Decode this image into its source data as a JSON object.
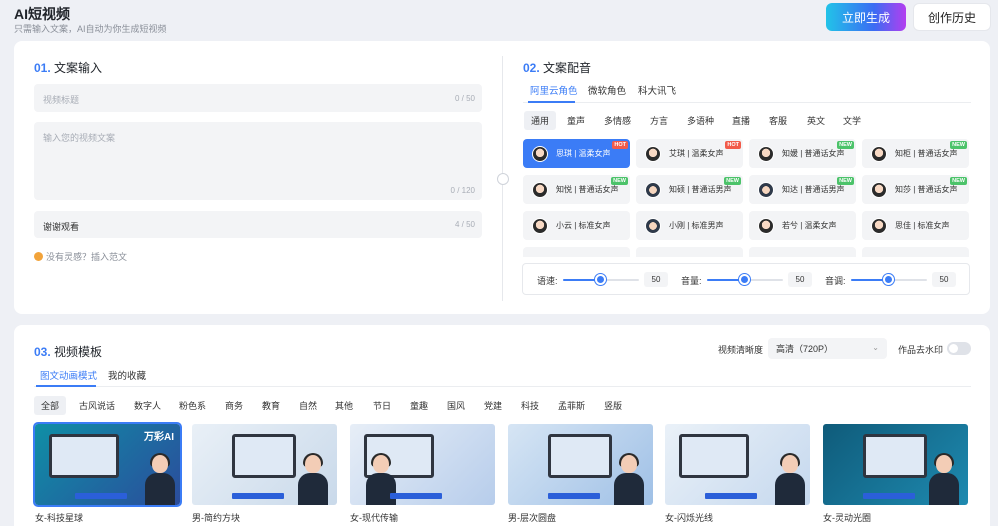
{
  "header": {
    "title": "AI短视频",
    "subtitle": "只需输入文案，AI自动为你生成短视频",
    "generate_button": "立即生成",
    "history_button": "创作历史"
  },
  "section1": {
    "num": "01.",
    "title": "文案输入",
    "title_field": {
      "placeholder": "视频标题",
      "count": "0 / 50"
    },
    "content_field": {
      "placeholder": "输入您的视频文案",
      "count": "0 / 120"
    },
    "ending_field": {
      "value": "谢谢观看",
      "count": "4 / 50"
    },
    "inspiration": "没有灵感？插入范文"
  },
  "section2": {
    "num": "02.",
    "title": "文案配音",
    "providers": [
      "阿里云角色",
      "微软角色",
      "科大讯飞"
    ],
    "categories": [
      "通用",
      "童声",
      "多情感",
      "方言",
      "多语种",
      "直播",
      "客服",
      "英文",
      "文学"
    ],
    "voices": [
      {
        "label": "思琪 | 温柔女声",
        "badge": "HOT",
        "male": false
      },
      {
        "label": "艾琪 | 温柔女声",
        "badge": "HOT",
        "male": false
      },
      {
        "label": "知媛 | 普通话女声",
        "badge": "NEW",
        "male": false
      },
      {
        "label": "知柜 | 普通话女声",
        "badge": "NEW",
        "male": false
      },
      {
        "label": "知悦 | 普通话女声",
        "badge": "NEW",
        "male": false
      },
      {
        "label": "知硕 | 普通话男声",
        "badge": "NEW",
        "male": true
      },
      {
        "label": "知达 | 普通话男声",
        "badge": "NEW",
        "male": true
      },
      {
        "label": "知莎 | 普通话女声",
        "badge": "NEW",
        "male": false
      },
      {
        "label": "小云 | 标准女声",
        "badge": "",
        "male": false
      },
      {
        "label": "小刚 | 标准男声",
        "badge": "",
        "male": true
      },
      {
        "label": "若兮 | 温柔女声",
        "badge": "",
        "male": false
      },
      {
        "label": "思佳 | 标准女声",
        "badge": "",
        "male": false
      }
    ],
    "sliders": [
      {
        "label": "语速:",
        "value": "50",
        "fraction": 0.5
      },
      {
        "label": "音量:",
        "value": "50",
        "fraction": 0.5
      },
      {
        "label": "音调:",
        "value": "50",
        "fraction": 0.5
      }
    ]
  },
  "section3": {
    "num": "03.",
    "title": "视频模板",
    "tabs": [
      "图文动画模式",
      "我的收藏"
    ],
    "quality_label": "视频清晰度",
    "quality_value": "高清（720P）",
    "watermark_label": "作品去水印",
    "filters": [
      "全部",
      "古风说话",
      "数字人",
      "粉色系",
      "商务",
      "教育",
      "自然",
      "其他",
      "节日",
      "童趣",
      "国风",
      "党建",
      "科技",
      "孟菲斯",
      "竖版"
    ],
    "templates": [
      {
        "name": "女-科技星球",
        "brand": "万彩AI",
        "bg": "#0f8fa6",
        "bg2": "#2b4c9c"
      },
      {
        "name": "男-简约方块",
        "brand": "",
        "bg": "#e9f0f7",
        "bg2": "#c9d9ea"
      },
      {
        "name": "女-现代传输",
        "brand": "",
        "bg": "#e7eef7",
        "bg2": "#b7cdeb"
      },
      {
        "name": "男-层次圆盘",
        "brand": "",
        "bg": "#d6e5f4",
        "bg2": "#9fc0e6"
      },
      {
        "name": "女-闪烁光线",
        "brand": "",
        "bg": "#eaf1f8",
        "bg2": "#c5d8ee"
      },
      {
        "name": "女-灵动光圈",
        "brand": "",
        "bg": "#0f5b7a",
        "bg2": "#1e8ab0"
      }
    ]
  },
  "icons": {
    "inspiration": "bulb-icon",
    "chevron": "chevron-down-icon"
  },
  "colors": {
    "accent": "#3b7cf6",
    "hot": "#f25b4a",
    "new": "#4cc36a"
  }
}
